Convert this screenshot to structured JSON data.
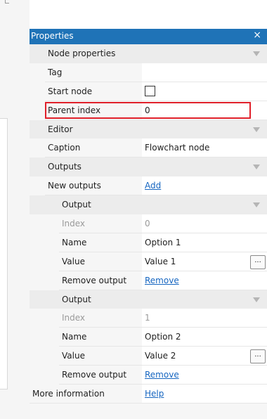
{
  "panel": {
    "title": "Properties",
    "close_glyph": "×"
  },
  "rows": {
    "node_properties": "Node properties",
    "tag": "Tag",
    "tag_value": "",
    "start_node": "Start node",
    "parent_index": "Parent index",
    "parent_index_value": "0",
    "editor": "Editor",
    "caption": "Caption",
    "caption_value": "Flowchart node",
    "outputs": "Outputs",
    "new_outputs": "New outputs",
    "add_link": "Add",
    "output1": {
      "header": "Output",
      "index_label": "Index",
      "index_value": "0",
      "name_label": "Name",
      "name_value": "Option 1",
      "value_label": "Value",
      "value_value": "Value 1",
      "remove_label": "Remove output",
      "remove_link": "Remove",
      "ellipsis": "..."
    },
    "output2": {
      "header": "Output",
      "index_label": "Index",
      "index_value": "1",
      "name_label": "Name",
      "name_value": "Option 2",
      "value_label": "Value",
      "value_value": "Value 2",
      "remove_label": "Remove output",
      "remove_link": "Remove",
      "ellipsis": "..."
    },
    "more_information": "More information",
    "help_link": "Help"
  }
}
